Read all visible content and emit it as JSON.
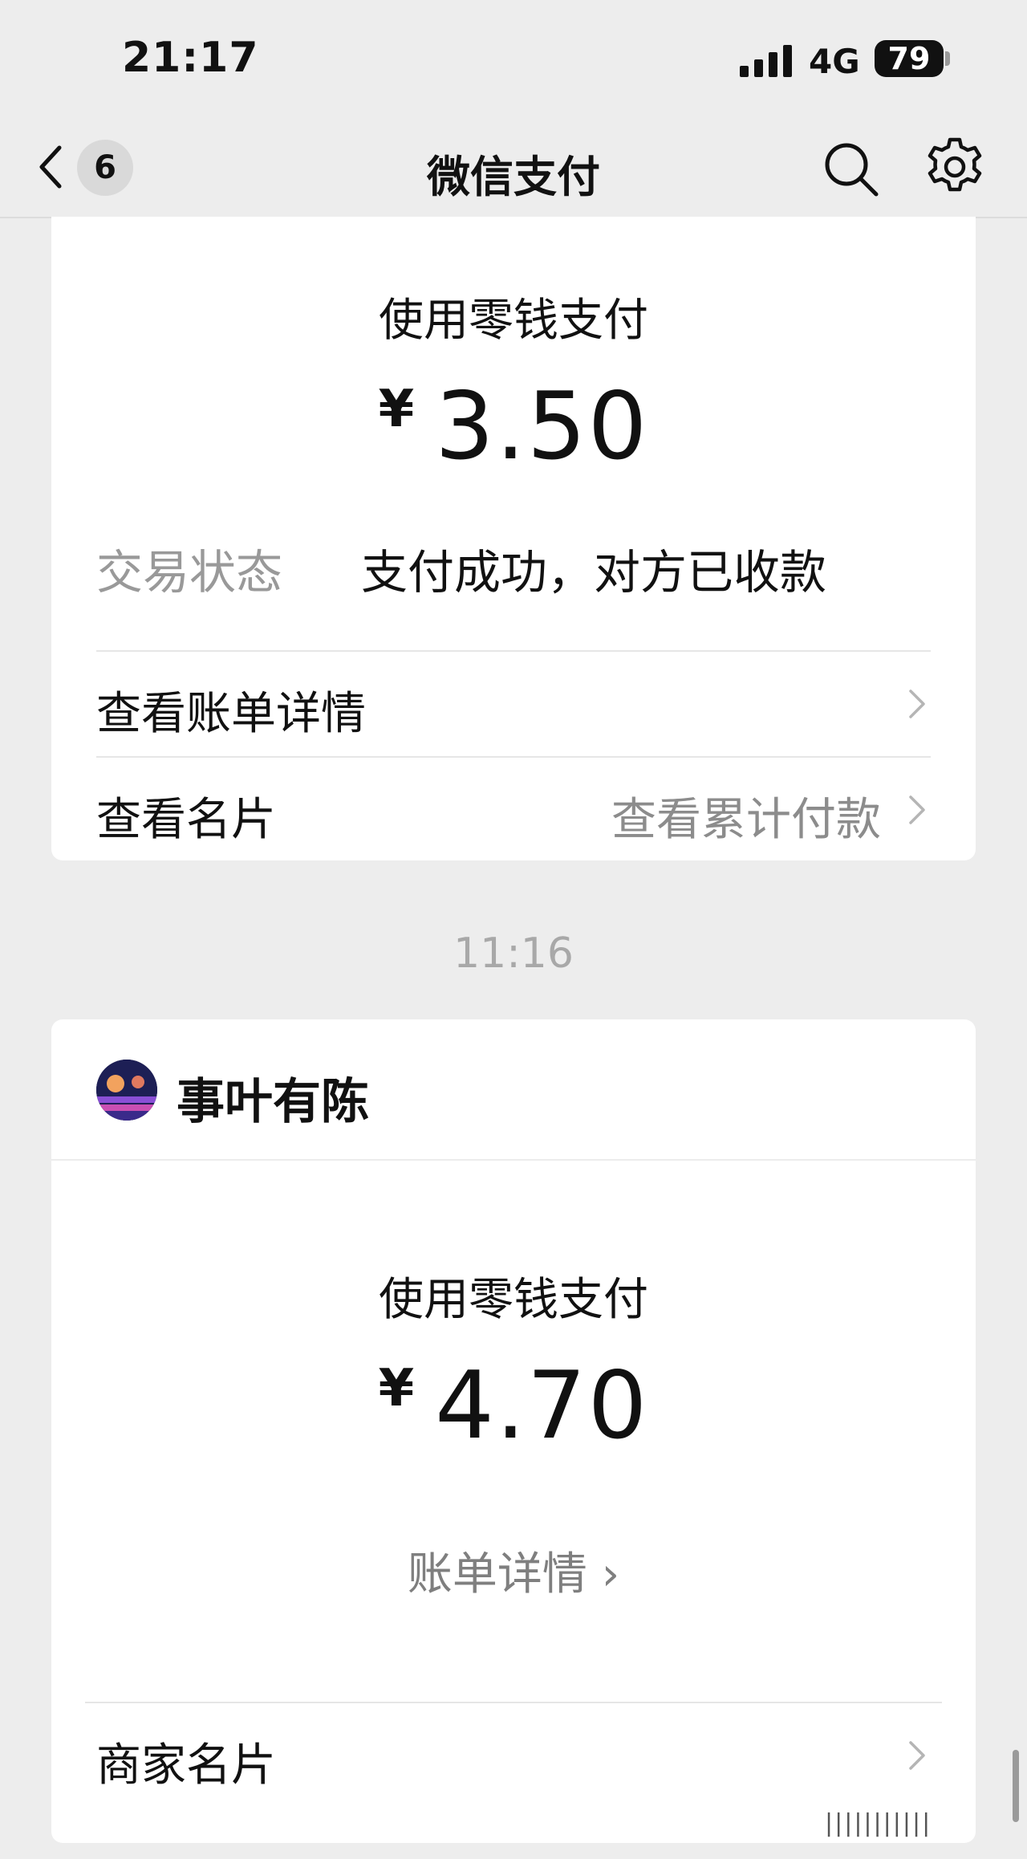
{
  "status_bar": {
    "time": "21:17",
    "network": "4G",
    "battery": "79"
  },
  "nav": {
    "unread_count": "6",
    "title": "微信支付"
  },
  "payment1": {
    "method_label": "使用零钱支付",
    "currency": "¥",
    "amount": "3.50",
    "status_label": "交易状态",
    "status_value": "支付成功，对方已收款",
    "view_bill_label": "查看账单详情",
    "view_card_label": "查看名片",
    "cumulative_label": "查看累计付款"
  },
  "separator_time": "11:16",
  "payment2": {
    "merchant_name": "事叶有陈",
    "method_label": "使用零钱支付",
    "currency": "¥",
    "amount": "4.70",
    "bill_detail_label": "账单详情 ›",
    "merchant_card_label": "商家名片"
  },
  "watermark": "|||||||||||",
  "colors": {
    "background": "#ededed",
    "card": "#ffffff",
    "muted_text": "#999999"
  }
}
